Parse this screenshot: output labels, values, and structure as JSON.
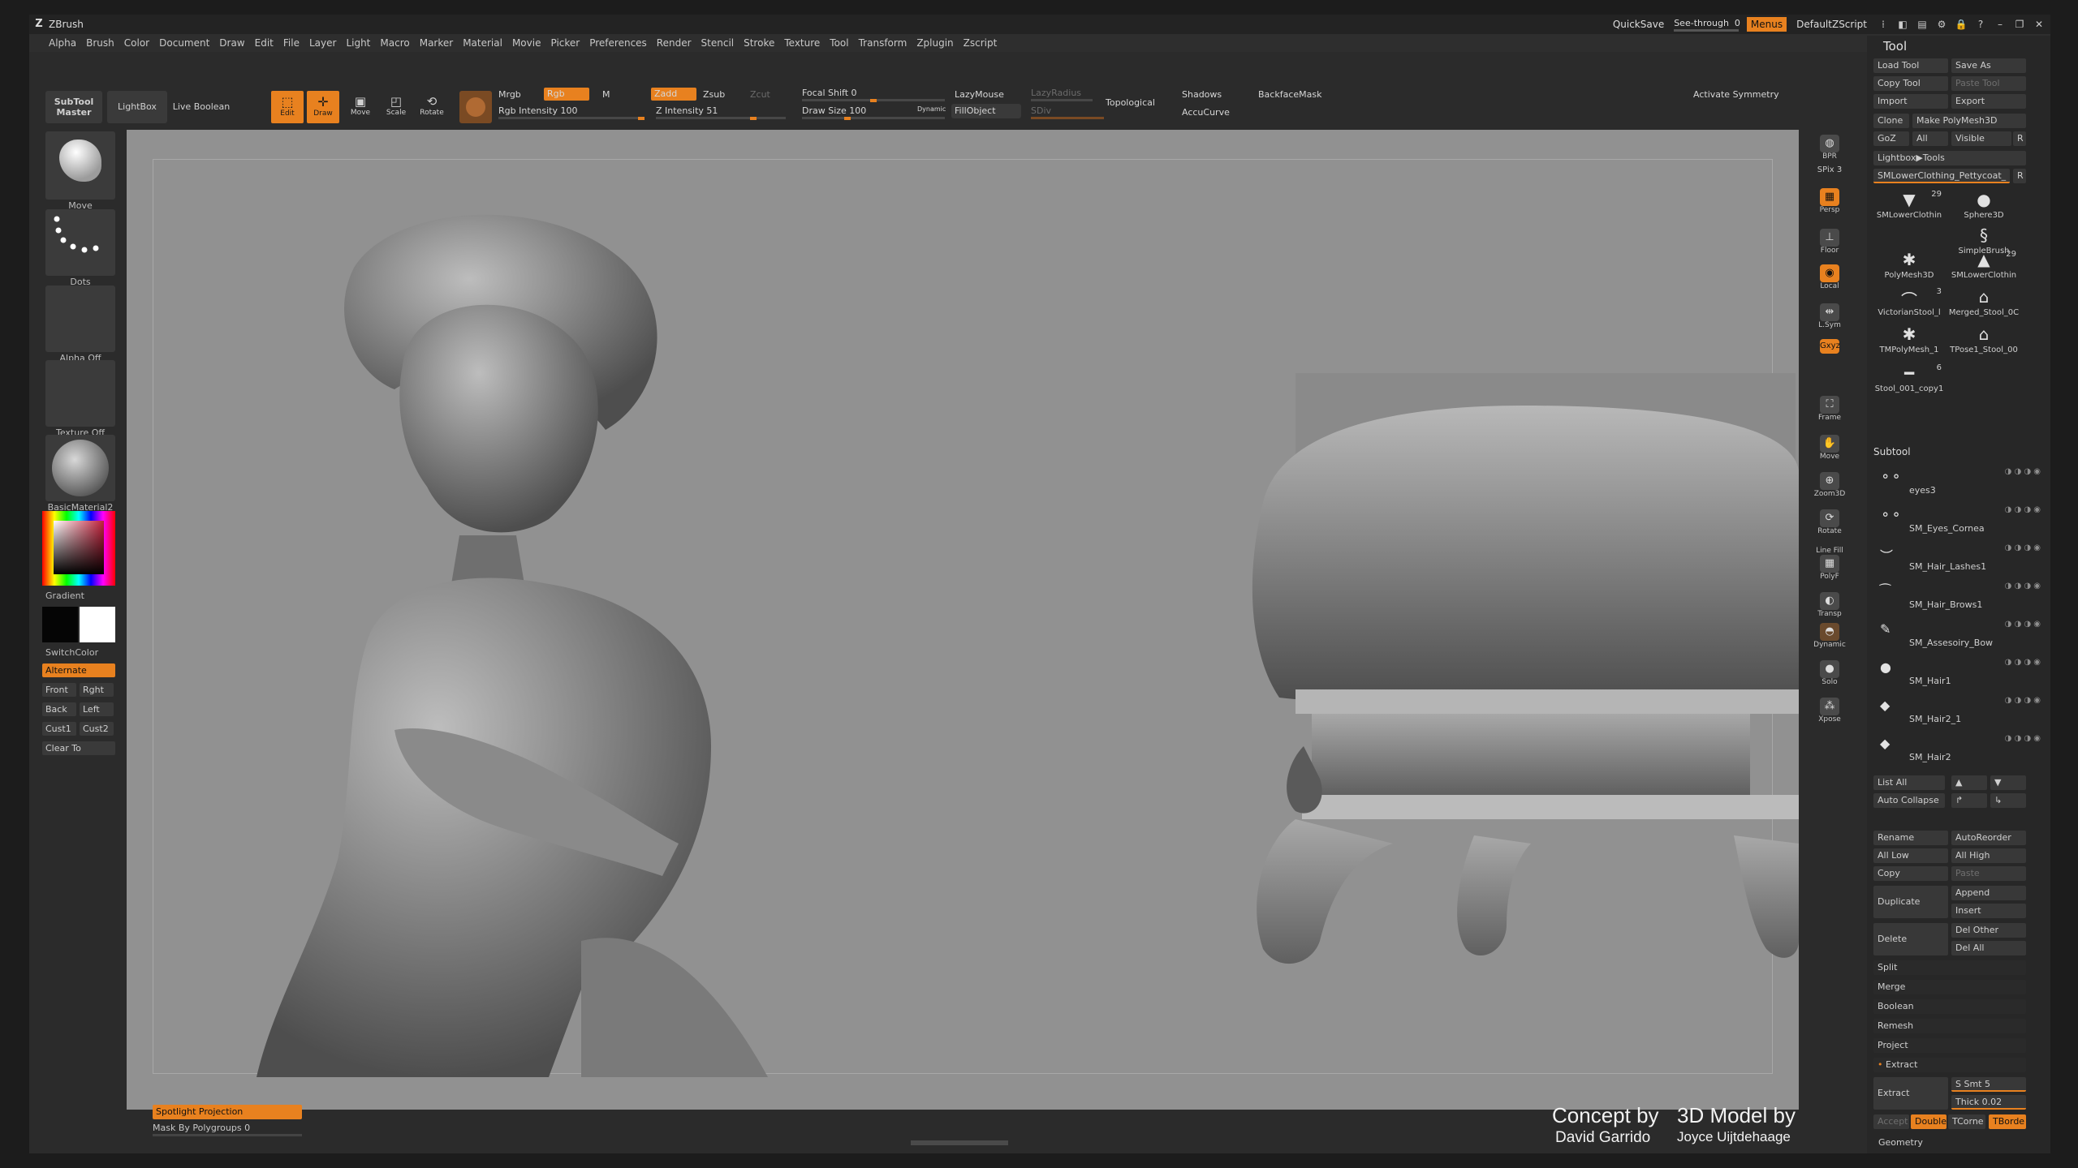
{
  "titlebar": {
    "app_title": "ZBrush",
    "quicksave": "QuickSave",
    "seethrough_label": "See-through",
    "seethrough_value": "0",
    "menus": "Menus",
    "script": "DefaultZScript"
  },
  "menus": [
    "Alpha",
    "Brush",
    "Color",
    "Document",
    "Draw",
    "Edit",
    "File",
    "Layer",
    "Light",
    "Macro",
    "Marker",
    "Material",
    "Movie",
    "Picker",
    "Preferences",
    "Render",
    "Stencil",
    "Stroke",
    "Texture",
    "Tool",
    "Transform",
    "Zplugin",
    "Zscript"
  ],
  "toolbar": {
    "subtool_master": "SubTool Master",
    "lightbox": "LightBox",
    "live_boolean": "Live Boolean",
    "edit": "Edit",
    "draw": "Draw",
    "move": "Move",
    "scale": "Scale",
    "rotate": "Rotate",
    "mrgb": "Mrgb",
    "rgb": "Rgb",
    "m": "M",
    "rgb_intensity": "Rgb Intensity 100",
    "zadd": "Zadd",
    "zsub": "Zsub",
    "zcut": "Zcut",
    "z_intensity": "Z Intensity 51",
    "focal_shift": "Focal Shift 0",
    "draw_size": "Draw Size 100",
    "dynamic": "Dynamic",
    "lazymouse": "LazyMouse",
    "lazyradius": "LazyRadius",
    "fillobject": "FillObject",
    "sdiv": "SDiv",
    "topological": "Topological",
    "shadows": "Shadows",
    "accucurve": "AccuCurve",
    "backfacemask": "BackfaceMask",
    "activate_symmetry": "Activate Symmetry"
  },
  "left": {
    "move": "Move",
    "dots": "Dots",
    "alpha_off": "Alpha Off",
    "texture_off": "Texture Off",
    "material": "BasicMaterial2",
    "gradient": "Gradient",
    "switchcolor": "SwitchColor",
    "alternate": "Alternate",
    "front": "Front",
    "right": "Rght",
    "back": "Back",
    "left": "Left",
    "cust1": "Cust1",
    "cust2": "Cust2",
    "clear_to": "Clear To"
  },
  "shelf": {
    "bpr": "BPR",
    "spix": "SPix 3",
    "persp": "Persp",
    "floor": "Floor",
    "local": "Local",
    "lsym": "L.Sym",
    "gxyz": "Gxyz",
    "frame": "Frame",
    "move": "Move",
    "zoom3d": "Zoom3D",
    "rotate": "Rotate",
    "linefill": "Line Fill",
    "polyf": "PolyF",
    "transp": "Transp",
    "dynamic": "Dynamic",
    "solo": "Solo",
    "xpose": "Xpose"
  },
  "tool": {
    "header": "Tool",
    "load_tool": "Load Tool",
    "save_as": "Save As",
    "copy_tool": "Copy Tool",
    "paste_tool": "Paste Tool",
    "import": "Import",
    "export": "Export",
    "clone": "Clone",
    "make_polymesh": "Make PolyMesh3D",
    "goz": "GoZ",
    "all": "All",
    "visible": "Visible",
    "r": "R",
    "lightbox_tools": "Lightbox▶Tools",
    "current_tool": "SMLowerClothing_Pettycoat_",
    "thumbs": [
      {
        "name": "SMLowerClothin",
        "count": "29"
      },
      {
        "name": "Sphere3D",
        "count": ""
      },
      {
        "name": "SimpleBrush",
        "count": ""
      },
      {
        "name": "PolyMesh3D",
        "count": ""
      },
      {
        "name": "SMLowerClothin",
        "count": "29"
      },
      {
        "name": "VictorianStool_l",
        "count": "3"
      },
      {
        "name": "Merged_Stool_0C",
        "count": ""
      },
      {
        "name": "TMPolyMesh_1",
        "count": ""
      },
      {
        "name": "TPose1_Stool_00",
        "count": ""
      },
      {
        "name": "Stool_001_copy1",
        "count": "6"
      }
    ],
    "subtool_header": "Subtool",
    "subtools": [
      "eyes3",
      "SM_Eyes_Cornea",
      "SM_Hair_Lashes1",
      "SM_Hair_Brows1",
      "SM_Assesoiry_Bow",
      "SM_Hair1",
      "SM_Hair2_1",
      "SM_Hair2"
    ],
    "list_all": "List All",
    "auto_collapse": "Auto Collapse",
    "rename": "Rename",
    "autoreorder": "AutoReorder",
    "all_low": "All Low",
    "all_high": "All High",
    "copy": "Copy",
    "paste": "Paste",
    "duplicate": "Duplicate",
    "append": "Append",
    "insert": "Insert",
    "delete": "Delete",
    "del_other": "Del Other",
    "del_all": "Del All",
    "split": "Split",
    "merge": "Merge",
    "boolean": "Boolean",
    "remesh": "Remesh",
    "project": "Project",
    "extract_header": "Extract",
    "extract": "Extract",
    "s_smt": "S Smt 5",
    "thick": "Thick 0.02",
    "accept": "Accept",
    "double": "Double",
    "tcorne": "TCorne",
    "tborde": "TBorde",
    "geometry": "Geometry"
  },
  "bottom": {
    "spotlight": "Spotlight Projection",
    "mask_by_polygroups": "Mask By Polygroups 0"
  },
  "credits": {
    "concept_title": "Concept by",
    "concept_name": "David Garrido",
    "model_title": "3D Model by",
    "model_name": "Joyce Uijtdehaage"
  },
  "colors": {
    "accent": "#e8811f",
    "viewport": "#919191"
  }
}
